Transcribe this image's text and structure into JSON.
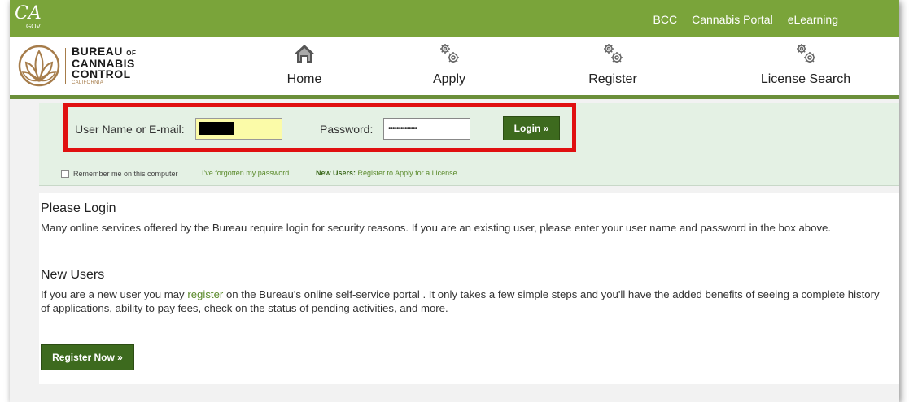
{
  "topbar": {
    "ca_logo": {
      "text": "CA",
      "sub": "GOV"
    },
    "links": [
      "BCC",
      "Cannabis Portal",
      "eLearning"
    ],
    "color": "#7aa43a"
  },
  "brand": {
    "line1": "BUREAU",
    "of": "OF",
    "line2": "CANNABIS",
    "line3": "CONTROL",
    "sub": "CALIFORNIA"
  },
  "nav": {
    "items": [
      {
        "label": "Home",
        "icon": "home-icon"
      },
      {
        "label": "Apply",
        "icon": "gears-icon"
      },
      {
        "label": "Register",
        "icon": "gears-icon"
      },
      {
        "label": "License Search",
        "icon": "gears-icon"
      }
    ]
  },
  "login": {
    "user_label": "User Name or E-mail:",
    "user_value": "",
    "password_label": "Password:",
    "password_value": "••••••••••••••",
    "login_button": "Login »",
    "remember_label": "Remember me on this computer",
    "forgot_link": "I've forgotten my password",
    "new_users_prefix": "New Users:",
    "new_users_link": "Register to Apply for a License"
  },
  "content": {
    "please_login_title": "Please Login",
    "please_login_text": "Many online services offered by the Bureau require login for security reasons. If you are an existing user, please enter your user name and password in the box above.",
    "new_users_title": "New Users",
    "new_users_text_before": "If you are a new user you may ",
    "new_users_link": "register",
    "new_users_text_after": " on the Bureau's online self-service portal . It only takes a few simple steps and you'll have the added benefits of seeing a complete history of applications, ability to pay fees, check on the status of pending activities, and more.",
    "register_button": "Register Now »"
  },
  "colors": {
    "accent_green": "#7aa43a",
    "button_green": "#3d6a1e",
    "highlight_red": "#e01010",
    "login_strip": "#e4f1e4"
  }
}
